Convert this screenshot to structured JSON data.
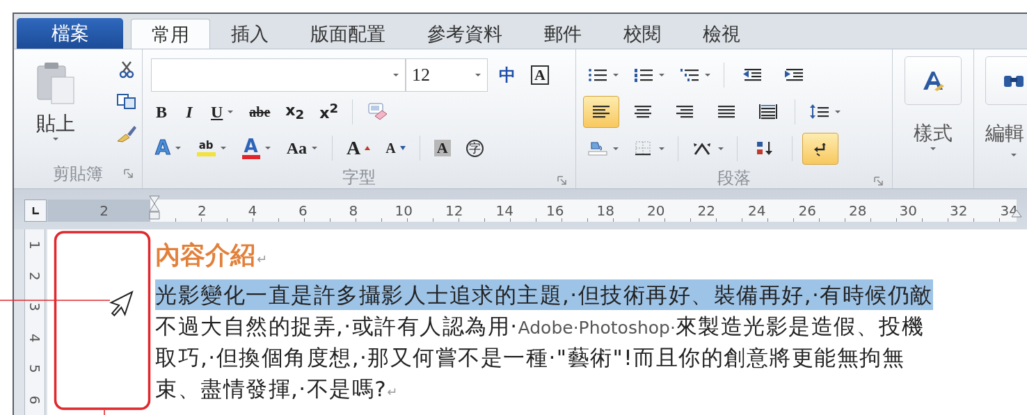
{
  "tabs": [
    {
      "label": "檔案",
      "kind": "file",
      "selected": false
    },
    {
      "label": "常用",
      "kind": "tab",
      "selected": true
    },
    {
      "label": "插入",
      "kind": "tab",
      "selected": false
    },
    {
      "label": "版面配置",
      "kind": "tab",
      "selected": false
    },
    {
      "label": "參考資料",
      "kind": "tab",
      "selected": false
    },
    {
      "label": "郵件",
      "kind": "tab",
      "selected": false
    },
    {
      "label": "校閱",
      "kind": "tab",
      "selected": false
    },
    {
      "label": "檢視",
      "kind": "tab",
      "selected": false
    }
  ],
  "ribbon": {
    "clipboard": {
      "label": "剪貼簿",
      "paste": "貼上"
    },
    "font": {
      "label": "字型",
      "size": "12",
      "rows": [
        {
          "buttons": [
            {
              "kind": "phonetic",
              "text": "中",
              "on": false
            },
            {
              "kind": "boxed",
              "text": "A",
              "on": false
            }
          ]
        },
        {
          "buttons": [
            {
              "kind": "bold",
              "text": "B",
              "on": false
            },
            {
              "kind": "italic",
              "text": "I",
              "on": false
            },
            {
              "kind": "underline",
              "text": "U",
              "on": false,
              "dropdown": true
            },
            {
              "kind": "strike",
              "text": "abe",
              "on": false
            },
            {
              "kind": "script",
              "text": "x$_{2}$",
              "on": false
            },
            {
              "kind": "script",
              "text": "x$^{2}$",
              "on": false
            },
            {
              "kind": "sep"
            },
            {
              "kind": "clear",
              "on": false
            }
          ]
        },
        {
          "buttons": [
            {
              "kind": "effects",
              "text": "A",
              "on": false,
              "dropdown": true
            },
            {
              "kind": "highlight",
              "text": "ab",
              "on": false,
              "dropdown": true
            },
            {
              "kind": "fontcolor",
              "text": "A",
              "on": false,
              "dropdown": true
            },
            {
              "kind": "case",
              "text": "Aa",
              "on": false,
              "dropdown": true
            },
            {
              "kind": "sep"
            },
            {
              "kind": "grow",
              "text": "A",
              "on": false
            },
            {
              "kind": "shrink",
              "text": "A",
              "on": false
            },
            {
              "kind": "sep"
            },
            {
              "kind": "shade",
              "text": "A",
              "on": false
            },
            {
              "kind": "enclose",
              "text": "字",
              "on": false
            }
          ]
        }
      ]
    },
    "paragraph": {
      "label": "段落",
      "rows": [
        {
          "buttons": [
            {
              "kind": "bullets",
              "on": false,
              "dropdown": true
            },
            {
              "kind": "numbering",
              "on": false,
              "dropdown": true
            },
            {
              "kind": "multilevel",
              "on": false,
              "dropdown": true
            },
            {
              "kind": "sep"
            },
            {
              "kind": "outdent",
              "on": false
            },
            {
              "kind": "indent",
              "on": false
            }
          ]
        },
        {
          "buttons": [
            {
              "kind": "align-left",
              "on": true
            },
            {
              "kind": "align-center",
              "on": false
            },
            {
              "kind": "align-right",
              "on": false
            },
            {
              "kind": "justify",
              "on": false
            },
            {
              "kind": "distribute",
              "on": false
            },
            {
              "kind": "sep"
            },
            {
              "kind": "spacing",
              "on": false,
              "dropdown": true
            }
          ]
        },
        {
          "buttons": [
            {
              "kind": "shading",
              "on": false,
              "dropdown": true
            },
            {
              "kind": "borders",
              "on": false,
              "dropdown": true
            },
            {
              "kind": "sep"
            },
            {
              "kind": "asian",
              "on": false,
              "dropdown": true
            },
            {
              "kind": "sep"
            },
            {
              "kind": "sort",
              "on": false
            },
            {
              "kind": "sep"
            },
            {
              "kind": "marks",
              "on": true
            }
          ]
        }
      ]
    },
    "styles": {
      "label": "樣式"
    },
    "editing": {
      "label": "編輯"
    }
  },
  "ruler": {
    "left_numbers": [
      "2"
    ],
    "numbers": [
      "2",
      "4",
      "6",
      "8",
      "10",
      "12",
      "14",
      "16",
      "18",
      "20",
      "22",
      "24",
      "26",
      "28",
      "30",
      "32",
      "34"
    ],
    "vertical_numbers": [
      "1",
      "2",
      "3",
      "4",
      "5",
      "6"
    ]
  },
  "document": {
    "heading": "內容介紹",
    "heading_mark": "↵",
    "lines": [
      {
        "selected": true,
        "segments": [
          {
            "kind": "cjk",
            "text": "光影變化一直是許多攝影人士追求的主題,·但技術再好、裝備再好,·有時候仍敵"
          }
        ]
      },
      {
        "selected": false,
        "segments": [
          {
            "kind": "cjk",
            "text": "不過大自然的捉弄,·或許有人認為用·"
          },
          {
            "kind": "latin",
            "text": "Adobe·Photoshop·"
          },
          {
            "kind": "cjk",
            "text": "來製造光影是造假、投機"
          }
        ]
      },
      {
        "selected": false,
        "segments": [
          {
            "kind": "cjk",
            "text": "取巧,·但換個角度想,·那又何嘗不是一種·\"藝術\"!而且你的創意將更能無拘無"
          }
        ]
      },
      {
        "selected": false,
        "segments": [
          {
            "kind": "cjk",
            "text": "束、盡情發揮,·不是嗎?"
          },
          {
            "kind": "mark",
            "text": "↵"
          }
        ]
      }
    ]
  }
}
